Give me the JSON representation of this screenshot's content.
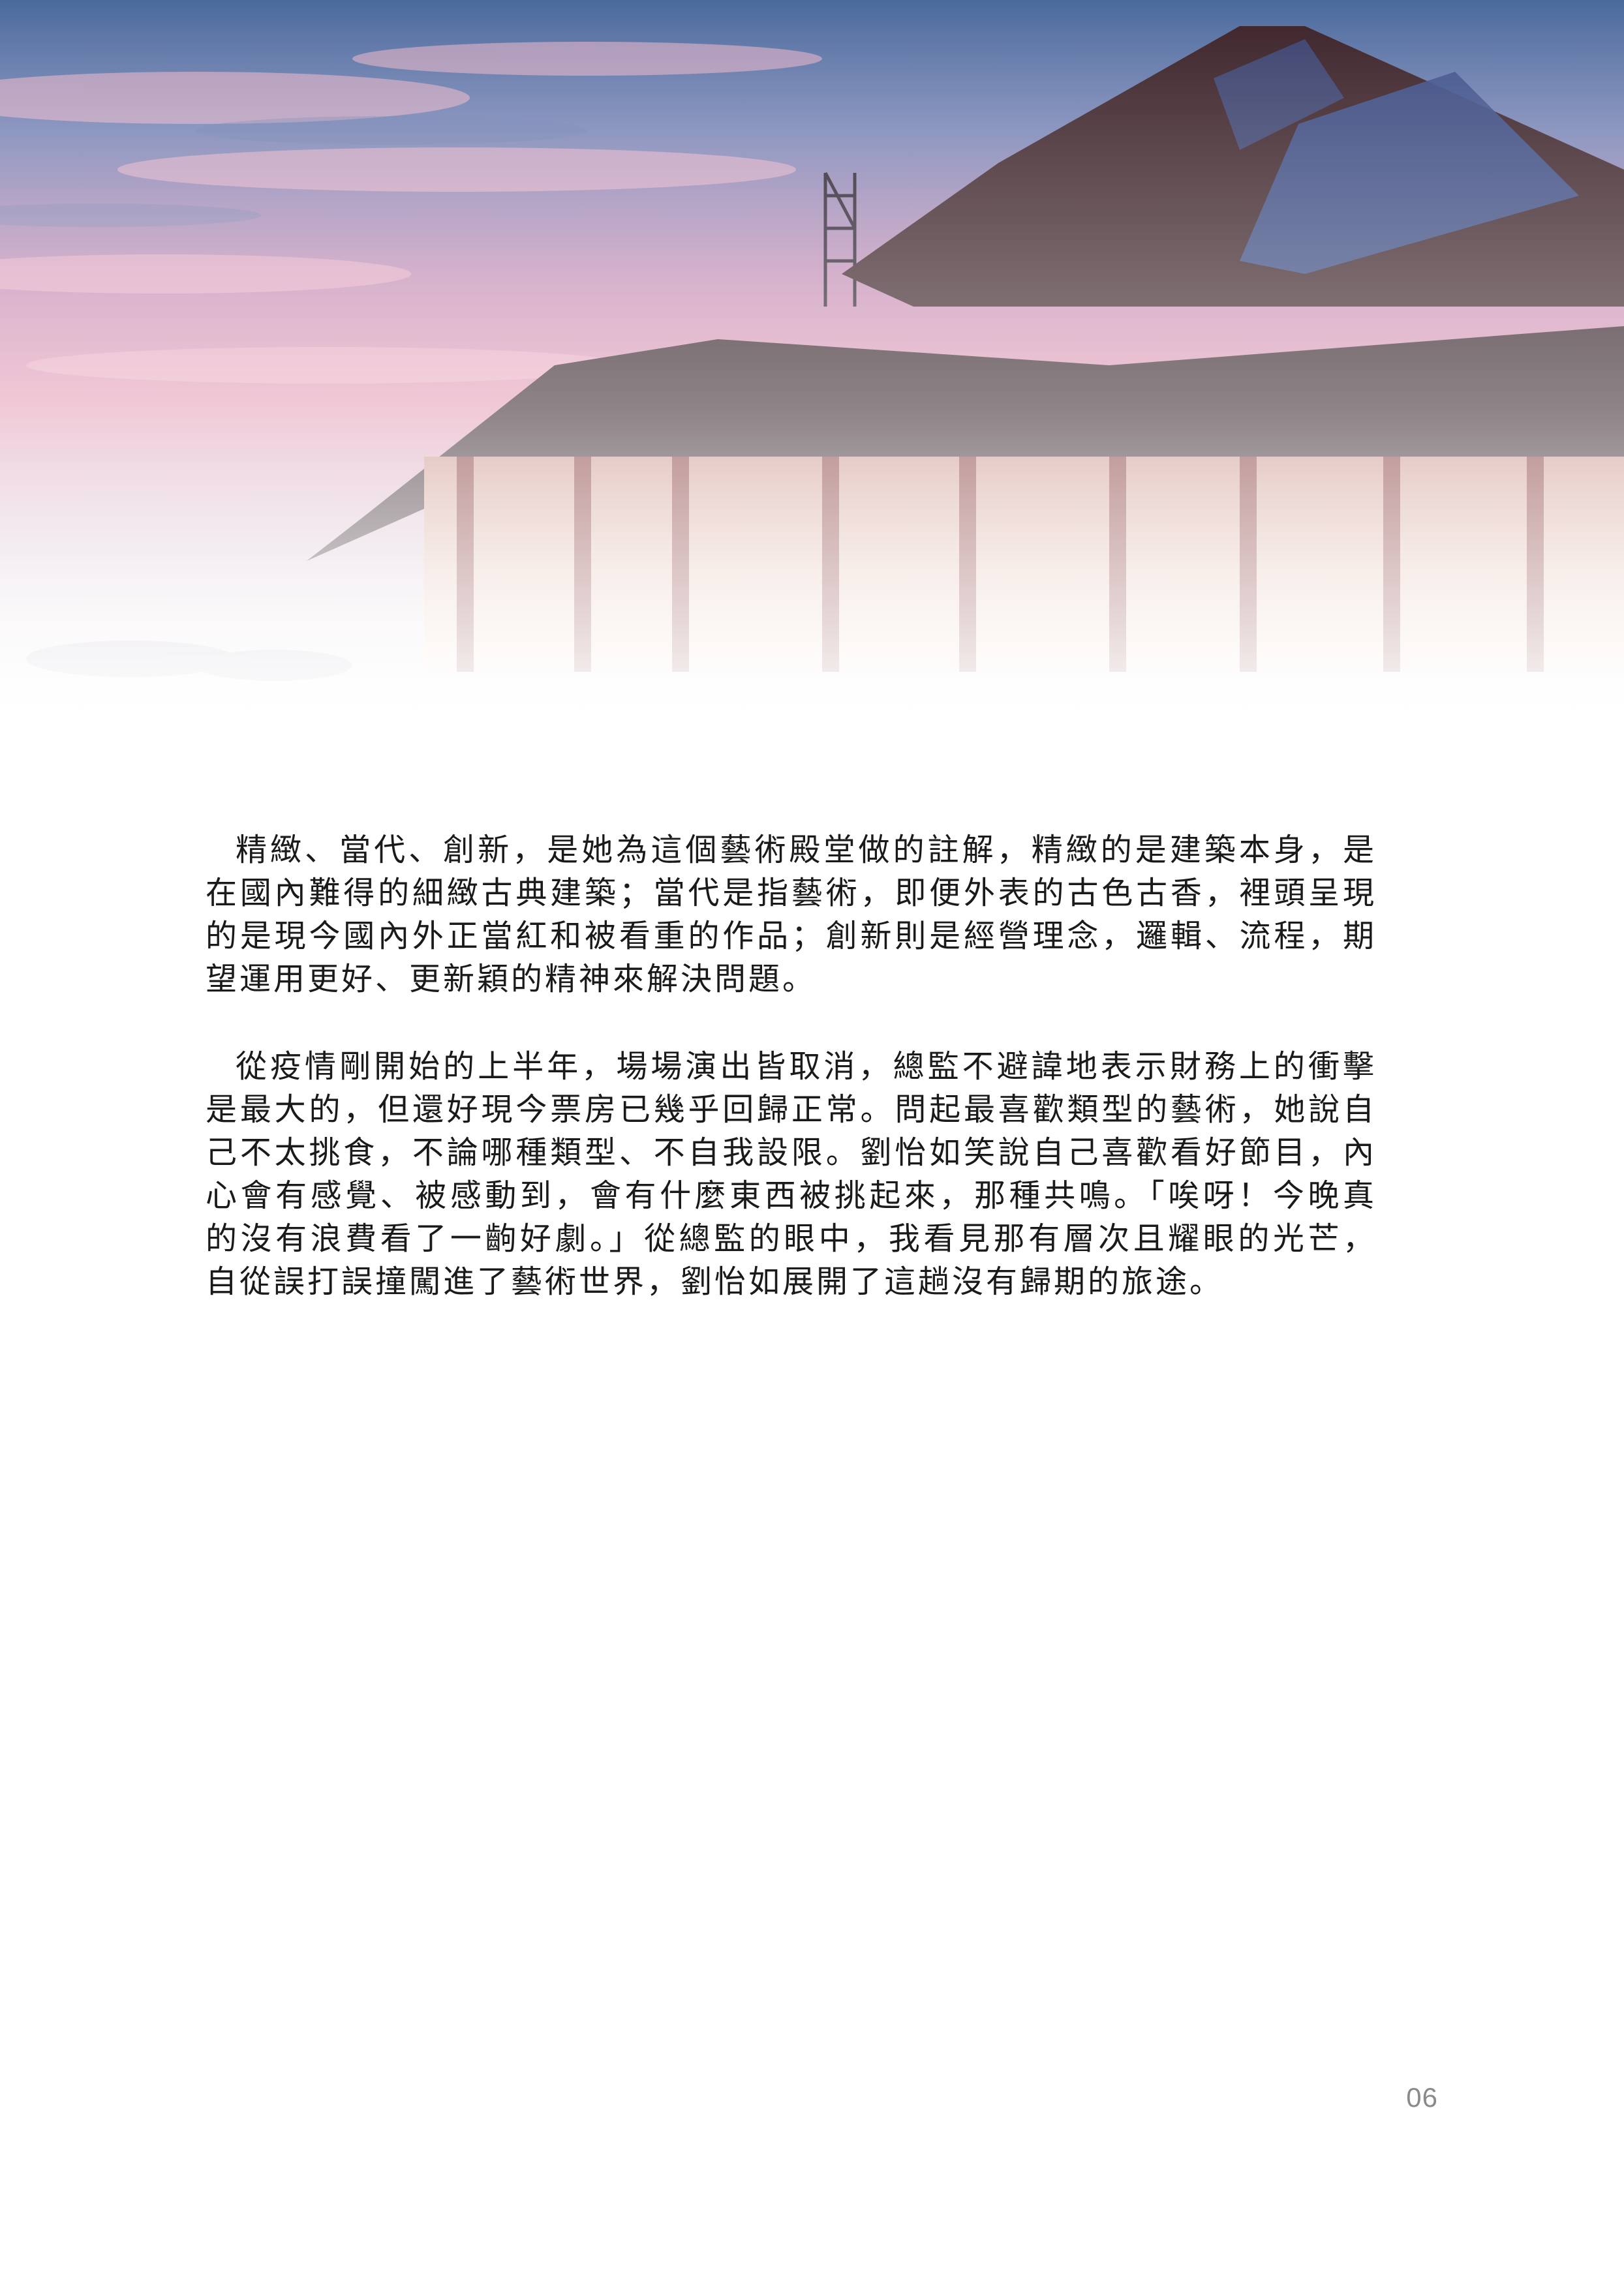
{
  "article": {
    "paragraphs": [
      "精緻、當代、創新，是她為這個藝術殿堂做的註解，精緻的是建築本身，是在國內難得的細緻古典建築；當代是指藝術，即便外表的古色古香，裡頭呈現的是現今國內外正當紅和被看重的作品；創新則是經營理念，邏輯、流程，期望運用更好、更新穎的精神來解決問題。",
      "從疫情剛開始的上半年，場場演出皆取消，總監不避諱地表示財務上的衝擊是最大的，但還好現今票房已幾乎回歸正常。問起最喜歡類型的藝術，她說自己不太挑食，不論哪種類型、不自我設限。劉怡如笑說自己喜歡看好節目，內心會有感覺、被感動到，會有什麼東西被挑起來，那種共鳴。「唉呀！今晚真的沒有浪費看了一齣好劇。」從總監的眼中，我看見那有層次且耀眼的光芒，自從誤打誤撞闖進了藝術世界，劉怡如展開了這趟沒有歸期的旅途。"
    ]
  },
  "footer": {
    "page_number": "06"
  },
  "colors": {
    "sky_top": "#4a6a9c",
    "sky_pink": "#d98fae",
    "roof": "#3b2228",
    "gable_blue": "#3c4f8a",
    "hall_glow": "#f3d5c2",
    "text": "#1a1a1a",
    "page_number": "#8a8a8a"
  }
}
